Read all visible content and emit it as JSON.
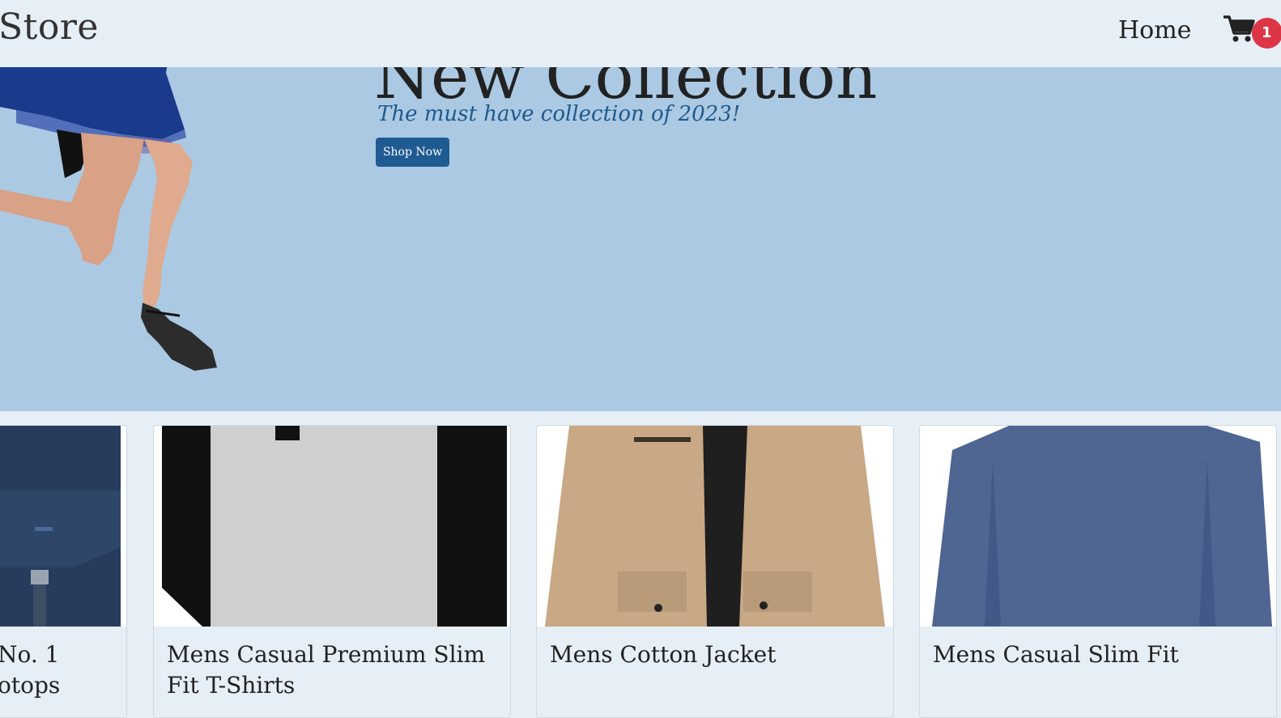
{
  "navbar": {
    "brand": "Store",
    "home_label": "Home",
    "cart_count": "1"
  },
  "hero": {
    "title": "New Collection",
    "subtitle": "The must have collection of 2023!",
    "shop_button_label": "Shop Now"
  },
  "products": [
    {
      "title": "No. 1\notops",
      "image": "backpack"
    },
    {
      "title": "Mens Casual Premium Slim Fit T-Shirts",
      "image": "raglan-tshirt"
    },
    {
      "title": "Mens Cotton Jacket",
      "image": "cotton-jacket"
    },
    {
      "title": "Mens Casual Slim Fit",
      "image": "slim-fit-shirt"
    }
  ],
  "colors": {
    "navbar_bg": "#e6eef6",
    "hero_bg": "#abc9e3",
    "button_bg": "#1f5b92",
    "subtitle": "#1e5a8c",
    "badge": "#dc3545"
  },
  "icons": {
    "cart": "cart-icon"
  }
}
